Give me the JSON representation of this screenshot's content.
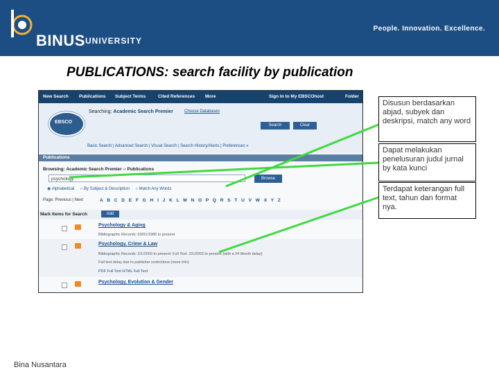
{
  "header": {
    "logo_text": "BINUS",
    "logo_sub": "UNIVERSITY",
    "tagline": "People. Innovation. Excellence."
  },
  "slide": {
    "title": "PUBLICATIONS: search facility by publication"
  },
  "screenshot": {
    "topnav": [
      "New Search",
      "Publications",
      "Subject Terms",
      "Cited References",
      "More"
    ],
    "topnav_right": [
      "Sign In to My EBSCOhost",
      "Folder"
    ],
    "logo_text": "EBSCO",
    "searching_prefix": "Searching:",
    "searching_db": "Academic Search Premier",
    "choose_db": "Choose Databases",
    "search_button": "Search",
    "clear_button": "Clear",
    "search_modes": "Basic Search   |   Advanced Search   |   Visual Search   |   Search History/Alerts   |   Preferences »",
    "publications_bar": "Publications",
    "browsing": "Browsing: Academic Search Premier -- Publications",
    "browse_input": "psychology",
    "browse_button": "Browse",
    "radio_alpha": "Alphabetical",
    "radio_subject": "By Subject & Description",
    "radio_match": "Match Any Words",
    "pages": "Page: Previous | Next",
    "alphabet": "A B C D E F G H I J K L M N O P Q R S T U V W X Y Z",
    "mark_items": "Mark Items for Search",
    "add_button": "Add",
    "results": [
      {
        "title": "Psychology & Aging",
        "meta": "Bibliographic Records: 03/01/1985 to present"
      },
      {
        "title": "Psychology, Crime & Law",
        "meta": "Bibliographic Records: 2/1/2003 to present; Full Text: 2/1/2003 to present (with a 24 Month delay)",
        "meta2": "Full text delay due to publisher restrictions (more info)",
        "meta3": "PDF Full Text   HTML Full Text"
      },
      {
        "title": "Psychology, Evolution & Gender",
        "meta": ""
      }
    ]
  },
  "callouts": [
    {
      "text": "Disusun berdasarkan abjad, subyek dan deskripsi, match any word"
    },
    {
      "text": "Dapat melakukan penelusuran judul jurnal by kata kunci"
    },
    {
      "text": "Terdapat keterangan full text, tahun dan format nya."
    }
  ],
  "colors": {
    "banner": "#1d4e83",
    "arrow": "#3fd93f"
  },
  "footer": {
    "text": "Bina Nusantara"
  }
}
